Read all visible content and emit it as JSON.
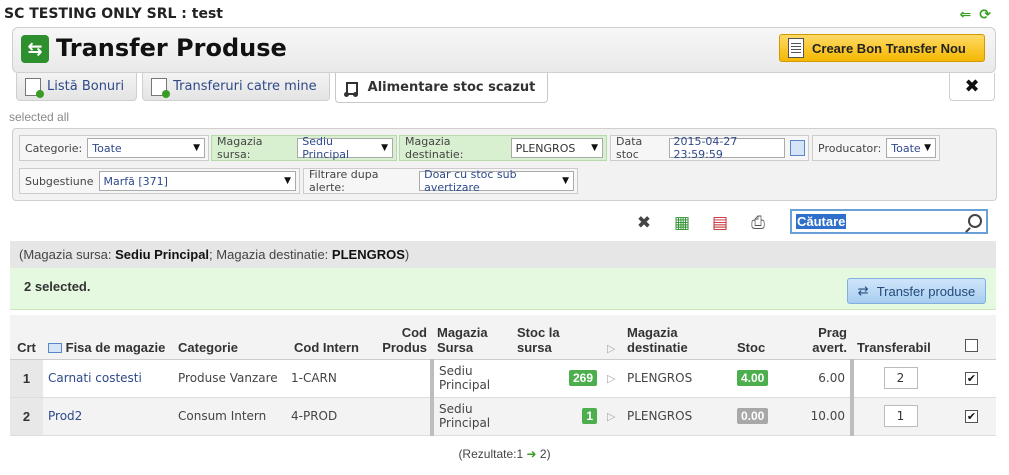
{
  "company": "SC TESTING ONLY SRL : test",
  "title": "Transfer Produse",
  "create_button": "Creare Bon Transfer Nou",
  "tabs": [
    {
      "label": "Listă Bonuri"
    },
    {
      "label": "Transferuri catre mine"
    },
    {
      "label": "Alimentare stoc scazut"
    }
  ],
  "selected_all": "selected all",
  "filters": {
    "categorie_label": "Categorie:",
    "categorie_value": "Toate",
    "sursa_label": "Magazia sursa:",
    "sursa_value": "Sediu Principal",
    "destinatie_label": "Magazia destinatie:",
    "destinatie_value": "PLENGROS",
    "data_label": "Data stoc",
    "data_value": "2015-04-27 23:59:59",
    "producator_label": "Producator:",
    "producator_value": "Toate",
    "subgestiune_label": "Subgestiune",
    "subgestiune_value": "Marfă [371]",
    "alerte_label": "Filtrare dupa alerte:",
    "alerte_value": "Doar cu stoc sub avertizare"
  },
  "search": {
    "text": "Căutare"
  },
  "info": {
    "sursa_label": "Magazia sursa:",
    "sursa_value": "Sediu Principal",
    "dest_label": "Magazia destinatie:",
    "dest_value": "PLENGROS"
  },
  "selection": {
    "count_text": "2 selected.",
    "transfer_button": "Transfer produse"
  },
  "table": {
    "headers": {
      "crt": "Crt",
      "fisa": "Fisa de magazie",
      "categorie": "Categorie",
      "cod_intern": "Cod Intern",
      "cod_produs": "Cod Produs",
      "magazia_sursa": "Magazia Sursa",
      "stoc_sursa": "Stoc la sursa",
      "magazia_dest": "Magazia destinatie",
      "stoc": "Stoc",
      "prag": "Prag avert.",
      "transferabil": "Transferabil"
    },
    "rows": [
      {
        "crt": "1",
        "fisa": "Carnati costesti",
        "categorie": "Produse Vanzare",
        "cod_intern": "1-CARN",
        "cod_produs": "",
        "sursa": "Sediu Principal",
        "stoc_sursa": "269",
        "dest": "PLENGROS",
        "stoc": "4.00",
        "prag": "6.00",
        "transferabil": "2"
      },
      {
        "crt": "2",
        "fisa": "Prod2",
        "categorie": "Consum Intern",
        "cod_intern": "4-PROD",
        "cod_produs": "",
        "sursa": "Sediu Principal",
        "stoc_sursa": "1",
        "dest": "PLENGROS",
        "stoc": "0.00",
        "prag": "10.00",
        "transferabil": "1"
      }
    ]
  },
  "footer": {
    "prefix": "(Rezultate:1",
    "suffix": "2)"
  },
  "icons": {
    "title": "transfer-arrows-icon",
    "create": "document-list-icon",
    "tools": "tools-icon",
    "excel": "excel-icon",
    "pdf": "pdf-icon",
    "print": "printer-icon",
    "search": "search-icon"
  },
  "colors": {
    "accent": "#f5b800",
    "green": "#4cae4c",
    "selection_bg": "#e5f8e0"
  }
}
